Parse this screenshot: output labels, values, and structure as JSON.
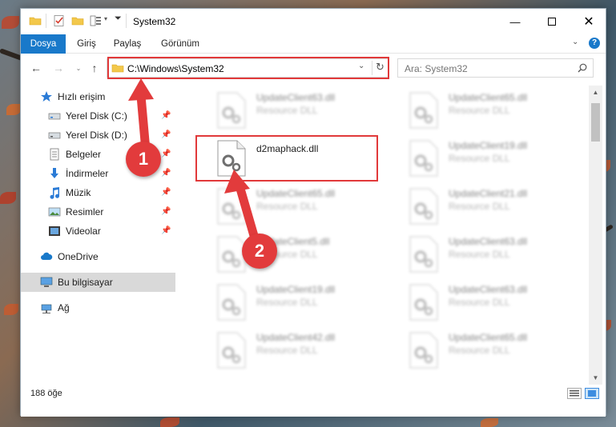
{
  "window": {
    "title": "System32"
  },
  "ribbon": {
    "tabs": [
      "Dosya",
      "Giriş",
      "Paylaş",
      "Görünüm"
    ]
  },
  "address": {
    "path": "C:\\Windows\\System32"
  },
  "search": {
    "placeholder": "Ara: System32"
  },
  "sidebar": {
    "items": [
      {
        "label": "Hızlı erişim",
        "icon": "star-icon"
      },
      {
        "label": "Yerel Disk (C:)",
        "icon": "drive-icon"
      },
      {
        "label": "Yerel Disk (D:)",
        "icon": "drive-icon"
      },
      {
        "label": "Belgeler",
        "icon": "document-icon"
      },
      {
        "label": "İndirmeler",
        "icon": "download-icon"
      },
      {
        "label": "Müzik",
        "icon": "music-icon"
      },
      {
        "label": "Resimler",
        "icon": "pictures-icon"
      },
      {
        "label": "Videolar",
        "icon": "video-icon"
      },
      {
        "label": "OneDrive",
        "icon": "cloud-icon"
      },
      {
        "label": "Bu bilgisayar",
        "icon": "computer-icon"
      },
      {
        "label": "Ağ",
        "icon": "network-icon"
      }
    ]
  },
  "files": [
    {
      "name": "UpdateClient63.dll",
      "type": "Resource DLL"
    },
    {
      "name": "UpdateClient65.dll",
      "type": "Resource DLL"
    },
    {
      "name": "d2maphack.dll",
      "type": ""
    },
    {
      "name": "UpdateClient19.dll",
      "type": "Resource DLL"
    },
    {
      "name": "UpdateClient65.dll",
      "type": "Resource DLL"
    },
    {
      "name": "UpdateClient21.dll",
      "type": "Resource DLL"
    },
    {
      "name": "UpdateClient5.dll",
      "type": "Resource DLL"
    },
    {
      "name": "UpdateClient63.dll",
      "type": "Resource DLL"
    },
    {
      "name": "UpdateClient19.dll",
      "type": "Resource DLL"
    },
    {
      "name": "UpdateClient63.dll",
      "type": "Resource DLL"
    },
    {
      "name": "UpdateClient42.dll",
      "type": "Resource DLL"
    },
    {
      "name": "UpdateClient65.dll",
      "type": "Resource DLL"
    }
  ],
  "status": {
    "count": "188 öğe"
  },
  "callouts": {
    "one": "1",
    "two": "2"
  },
  "colors": {
    "accent": "#1979ca",
    "highlight": "#e1393a",
    "selected": "#d9d9d9"
  }
}
